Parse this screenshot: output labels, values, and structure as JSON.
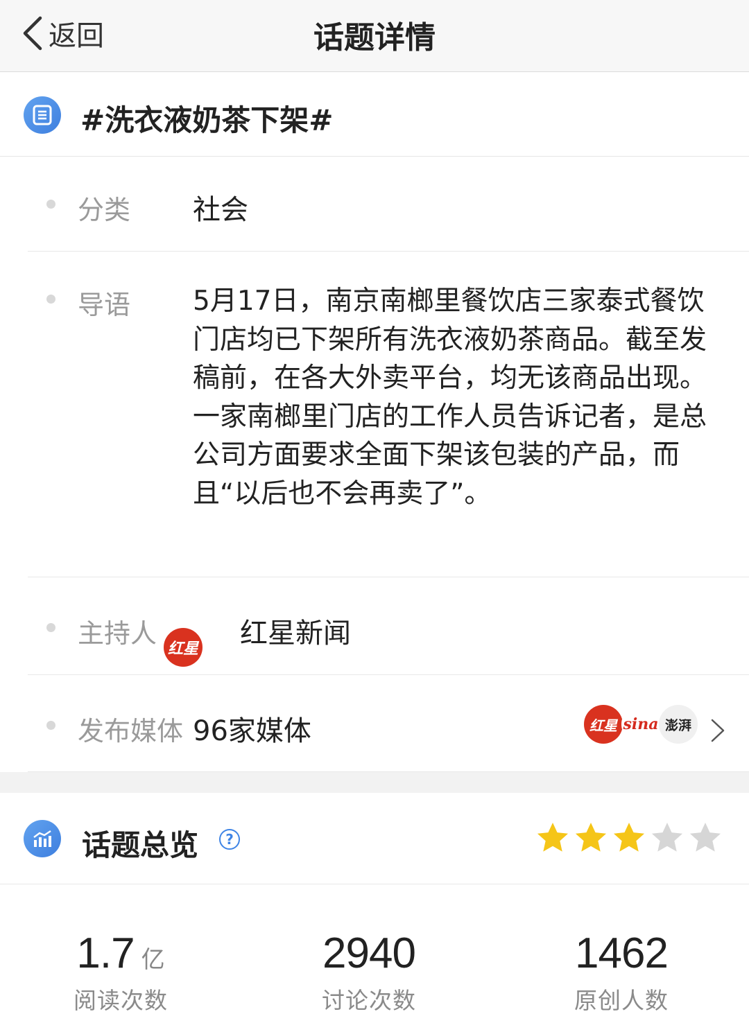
{
  "nav": {
    "back_label": "返回",
    "title": "话题详情"
  },
  "topic": {
    "title": "#洗衣液奶茶下架#",
    "icon": "document-list-icon"
  },
  "info": {
    "category": {
      "label": "分类",
      "value": "社会"
    },
    "intro": {
      "label": "导语",
      "text": "5月17日，南京南榔里餐饮店三家泰式餐饮门店均已下架所有洗衣液奶茶商品。截至发稿前，在各大外卖平台，均无该商品出现。一家南榔里门店的工作人员告诉记者，是总公司方面要求全面下架该包装的产品，而且“以后也不会再卖了”。"
    },
    "host": {
      "label": "主持人",
      "name": "红星新闻",
      "logo_text": "红星"
    },
    "media": {
      "label": "发布媒体",
      "value": "96家媒体",
      "logos": [
        "红星",
        "sina",
        "澎湃"
      ]
    }
  },
  "overview": {
    "title": "话题总览",
    "help": "?",
    "rating": {
      "value": 3,
      "max": 5,
      "active_color": "#f5c518",
      "inactive_color": "#d6d6d6"
    }
  },
  "stats": [
    {
      "value": "1.7",
      "unit": "亿",
      "label": "阅读次数"
    },
    {
      "value": "2940",
      "unit": "",
      "label": "讨论次数"
    },
    {
      "value": "1462",
      "unit": "",
      "label": "原创人数"
    }
  ],
  "colors": {
    "accent": "#3f84e5",
    "brand_red": "#d9321f"
  }
}
